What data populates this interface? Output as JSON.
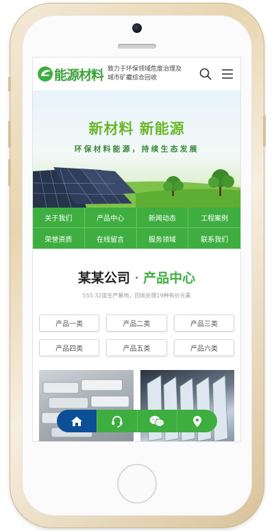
{
  "header": {
    "logo_text": "能源材料",
    "slogan": "致力于环保领域危废治理及城市矿藏综合回收"
  },
  "banner": {
    "title": "新材料 新能源",
    "subtitle": "环保材料能源，持续生态发展"
  },
  "nav": {
    "items": [
      {
        "label": "关于我们"
      },
      {
        "label": "产品中心"
      },
      {
        "label": "新闻动态"
      },
      {
        "label": "工程案例"
      },
      {
        "label": "荣誉资质"
      },
      {
        "label": "在线留言"
      },
      {
        "label": "服务领域"
      },
      {
        "label": "联系我们"
      }
    ]
  },
  "section": {
    "title_prefix": "某某公司",
    "title_dot": "·",
    "title_accent": "产品中心",
    "subtitle": "555.32亩生产基地，回收处理19种有价元素"
  },
  "categories": [
    {
      "label": "产品一类"
    },
    {
      "label": "产品二类"
    },
    {
      "label": "产品三类"
    },
    {
      "label": "产品四类"
    },
    {
      "label": "产品五类"
    },
    {
      "label": "产品六类"
    }
  ],
  "bottom_bar": {
    "icons": [
      "home-icon",
      "headset-icon",
      "wechat-icon",
      "location-icon"
    ]
  },
  "colors": {
    "brand_green": "#3eae40",
    "home_blue": "#0c4f97"
  }
}
